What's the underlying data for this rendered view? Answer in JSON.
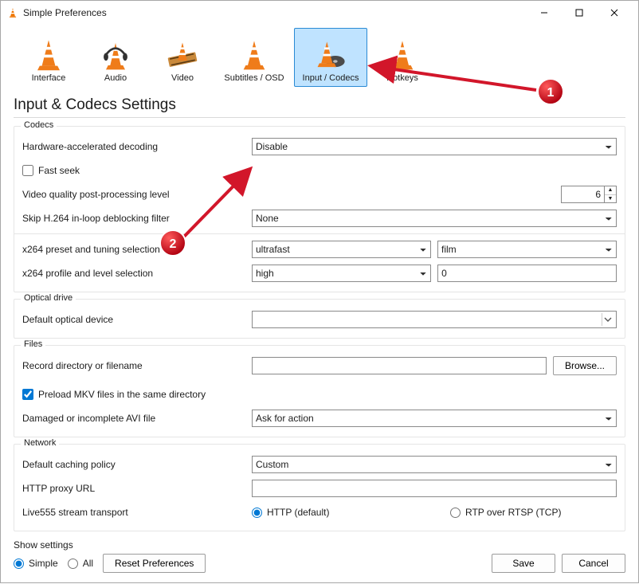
{
  "window": {
    "title": "Simple Preferences"
  },
  "tabs": {
    "interface": "Interface",
    "audio": "Audio",
    "video": "Video",
    "subtitles": "Subtitles / OSD",
    "inputcodecs": "Input / Codecs",
    "hotkeys": "Hotkeys"
  },
  "page_title": "Input & Codecs Settings",
  "codecs": {
    "title": "Codecs",
    "hw_decode_label": "Hardware-accelerated decoding",
    "hw_decode_value": "Disable",
    "fast_seek_label": "Fast seek",
    "fast_seek_checked": false,
    "pp_level_label": "Video quality post-processing level",
    "pp_level_value": "6",
    "skip_h264_label": "Skip H.264 in-loop deblocking filter",
    "skip_h264_value": "None",
    "x264_preset_label": "x264 preset and tuning selection",
    "x264_preset_value": "ultrafast",
    "x264_tuning_value": "film",
    "x264_profile_label": "x264 profile and level selection",
    "x264_profile_value": "high",
    "x264_level_value": "0"
  },
  "optical": {
    "title": "Optical drive",
    "default_device_label": "Default optical device",
    "default_device_value": ""
  },
  "files": {
    "title": "Files",
    "record_dir_label": "Record directory or filename",
    "record_dir_value": "",
    "browse_label": "Browse...",
    "preload_mkv_label": "Preload MKV files in the same directory",
    "preload_mkv_checked": true,
    "avi_label": "Damaged or incomplete AVI file",
    "avi_value": "Ask for action"
  },
  "network": {
    "title": "Network",
    "caching_label": "Default caching policy",
    "caching_value": "Custom",
    "proxy_label": "HTTP proxy URL",
    "proxy_value": "",
    "live555_label": "Live555 stream transport",
    "live555_http_label": "HTTP (default)",
    "live555_rtsp_label": "RTP over RTSP (TCP)",
    "live555_choice": "http"
  },
  "footer": {
    "show_settings_label": "Show settings",
    "simple_label": "Simple",
    "all_label": "All",
    "mode": "simple",
    "reset_label": "Reset Preferences",
    "save_label": "Save",
    "cancel_label": "Cancel"
  },
  "annotations": {
    "badge1": "1",
    "badge2": "2"
  }
}
